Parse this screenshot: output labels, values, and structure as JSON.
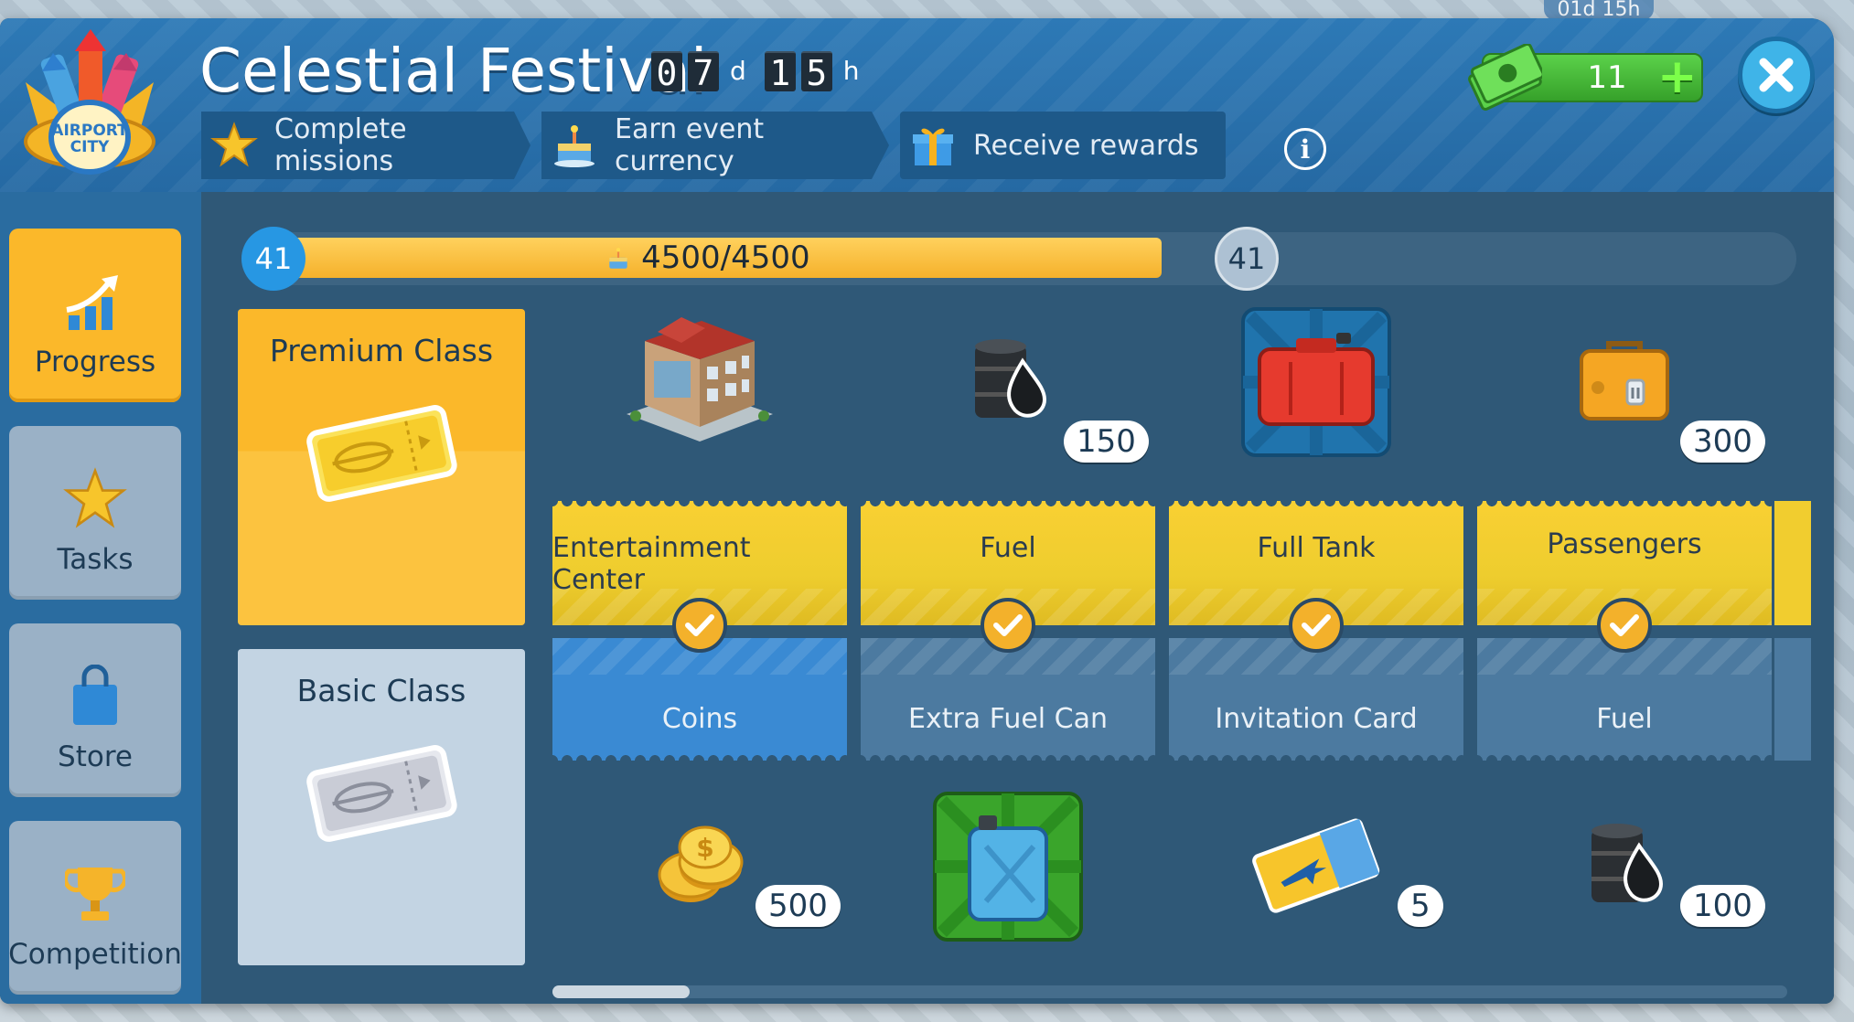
{
  "event": {
    "title": "Celestial Festival",
    "timer": {
      "days": [
        "0",
        "7"
      ],
      "day_unit": "d",
      "hours": [
        "1",
        "5"
      ],
      "hour_unit": "h"
    }
  },
  "background": {
    "timer": "01d 15h"
  },
  "logo_text": [
    "AIRPORT",
    "CITY"
  ],
  "steps": [
    {
      "label": "Complete missions",
      "icon": "star-icon"
    },
    {
      "label": "Earn event currency",
      "icon": "cake-icon"
    },
    {
      "label": "Receive rewards",
      "icon": "gift-icon"
    }
  ],
  "currency": {
    "cash": "11"
  },
  "sidebar": {
    "items": [
      {
        "label": "Progress",
        "icon": "progress-chart-icon",
        "active": true
      },
      {
        "label": "Tasks",
        "icon": "star-icon",
        "active": false
      },
      {
        "label": "Store",
        "icon": "shopping-bag-icon",
        "active": false
      },
      {
        "label": "Competition",
        "icon": "trophy-icon",
        "active": false
      }
    ]
  },
  "progress": {
    "level_current": "41",
    "level_next": "41",
    "text": "4500/4500",
    "fraction": 1.0
  },
  "classes": {
    "premium": {
      "label": "Premium Class"
    },
    "basic": {
      "label": "Basic Class"
    }
  },
  "rewards": [
    {
      "premium": {
        "label": "Entertainment Center",
        "qty": "",
        "icon": "building-icon"
      },
      "basic": {
        "label": "Coins",
        "qty": "500",
        "icon": "coins-icon"
      },
      "claimed": true
    },
    {
      "premium": {
        "label": "Fuel",
        "qty": "150",
        "icon": "oil-barrel-icon"
      },
      "basic": {
        "label": "Extra Fuel Can",
        "qty": "",
        "icon": "jerrycan-icon"
      },
      "claimed": true
    },
    {
      "premium": {
        "label": "Full Tank",
        "qty": "",
        "icon": "red-fuel-tank-icon"
      },
      "basic": {
        "label": "Invitation Card",
        "qty": "5",
        "icon": "plane-ticket-icon"
      },
      "claimed": true
    },
    {
      "premium": {
        "label": "Passengers",
        "qty": "300",
        "icon": "suitcase-icon"
      },
      "basic": {
        "label": "Fuel",
        "qty": "100",
        "icon": "oil-barrel-icon"
      },
      "claimed": true
    }
  ],
  "colors": {
    "accent_orange": "#fbb82a",
    "header_blue": "#2d79b6",
    "cash_green": "#36a12a",
    "close_blue": "#3fb4e8"
  }
}
